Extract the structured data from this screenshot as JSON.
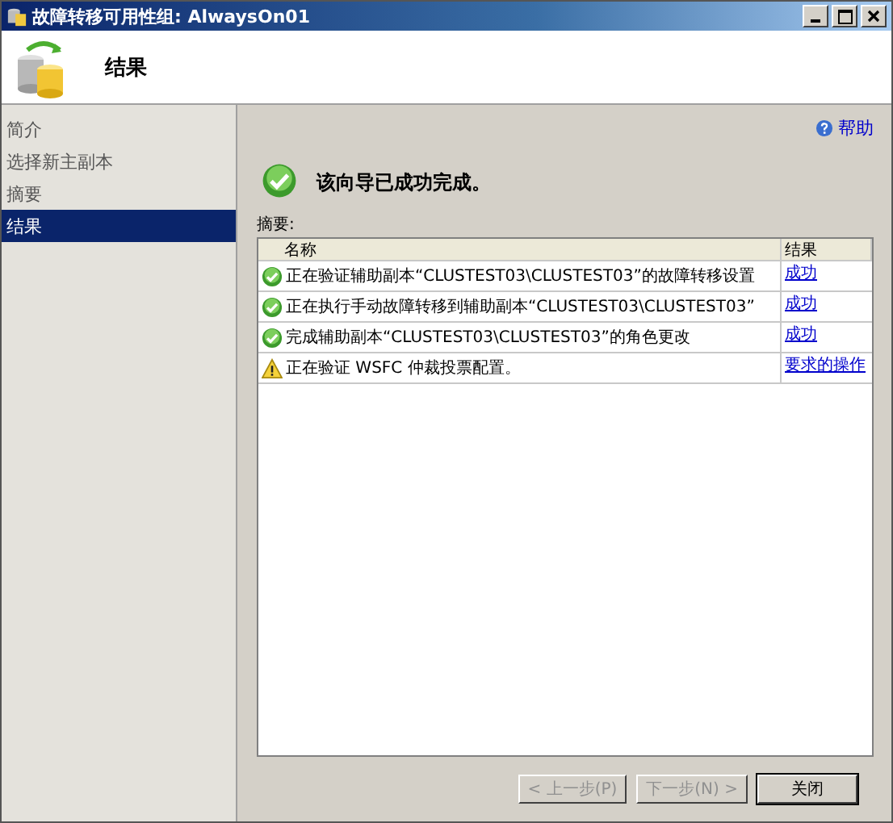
{
  "window": {
    "title": "故障转移可用性组: AlwaysOn01"
  },
  "header": {
    "title": "结果"
  },
  "sidebar": {
    "items": [
      {
        "label": "简介",
        "selected": false
      },
      {
        "label": "选择新主副本",
        "selected": false
      },
      {
        "label": "摘要",
        "selected": false
      },
      {
        "label": "结果",
        "selected": true
      }
    ]
  },
  "help_link": "帮助",
  "status": {
    "kind": "success",
    "message": "该向导已成功完成。"
  },
  "summary": {
    "label": "摘要:",
    "columns": [
      "名称",
      "结果"
    ],
    "rows": [
      {
        "kind": "success",
        "name": "正在验证辅助副本“CLUSTEST03\\CLUSTEST03”的故障转移设置",
        "result": "成功"
      },
      {
        "kind": "success",
        "name": "正在执行手动故障转移到辅助副本“CLUSTEST03\\CLUSTEST03”",
        "result": "成功"
      },
      {
        "kind": "success",
        "name": "完成辅助副本“CLUSTEST03\\CLUSTEST03”的角色更改",
        "result": "成功"
      },
      {
        "kind": "warning",
        "name": "正在验证 WSFC 仲裁投票配置。",
        "result": "要求的操作"
      }
    ]
  },
  "buttons": [
    {
      "label": "< 上一步(P)",
      "disabled": true
    },
    {
      "label": "下一步(N) >",
      "disabled": true
    },
    {
      "label": "关闭",
      "disabled": false
    }
  ]
}
